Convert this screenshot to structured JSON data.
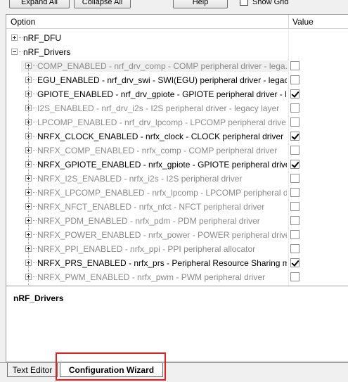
{
  "toolbar": {
    "expand_all": "Expand All",
    "collapse_all": "Collapse All",
    "help": "Help",
    "show_grid": "Show Grid"
  },
  "header": {
    "option": "Option",
    "value": "Value"
  },
  "tree": {
    "groups": [
      {
        "label": "nRF_DFU"
      },
      {
        "label": "nRF_Drivers"
      }
    ],
    "items": [
      {
        "label": "COMP_ENABLED - nrf_drv_comp - COMP peripheral driver - lega...",
        "enabled": false,
        "checked": false
      },
      {
        "label": "EGU_ENABLED  - nrf_drv_swi - SWI(EGU) peripheral driver - legac...",
        "enabled": true,
        "checked": false
      },
      {
        "label": "GPIOTE_ENABLED - nrf_drv_gpiote - GPIOTE peripheral driver - le...",
        "enabled": true,
        "checked": true
      },
      {
        "label": "I2S_ENABLED - nrf_drv_i2s - I2S peripheral driver - legacy layer",
        "enabled": false,
        "checked": false
      },
      {
        "label": "LPCOMP_ENABLED - nrf_drv_lpcomp - LPCOMP peripheral drive...",
        "enabled": false,
        "checked": false
      },
      {
        "label": "NRFX_CLOCK_ENABLED - nrfx_clock - CLOCK peripheral driver",
        "enabled": true,
        "checked": true
      },
      {
        "label": "NRFX_COMP_ENABLED - nrfx_comp - COMP peripheral driver",
        "enabled": false,
        "checked": false
      },
      {
        "label": "NRFX_GPIOTE_ENABLED - nrfx_gpiote - GPIOTE peripheral driver",
        "enabled": true,
        "checked": true
      },
      {
        "label": "NRFX_I2S_ENABLED - nrfx_i2s - I2S peripheral driver",
        "enabled": false,
        "checked": false
      },
      {
        "label": "NRFX_LPCOMP_ENABLED - nrfx_lpcomp - LPCOMP peripheral driv...",
        "enabled": false,
        "checked": false
      },
      {
        "label": "NRFX_NFCT_ENABLED - nrfx_nfct - NFCT peripheral driver",
        "enabled": false,
        "checked": false
      },
      {
        "label": "NRFX_PDM_ENABLED - nrfx_pdm - PDM peripheral driver",
        "enabled": false,
        "checked": false
      },
      {
        "label": "NRFX_POWER_ENABLED - nrfx_power - POWER peripheral driver",
        "enabled": false,
        "checked": false
      },
      {
        "label": "NRFX_PPI_ENABLED - nrfx_ppi - PPI peripheral allocator",
        "enabled": false,
        "checked": false
      },
      {
        "label": "NRFX_PRS_ENABLED - nrfx_prs - Peripheral Resource Sharing mo...",
        "enabled": true,
        "checked": true
      },
      {
        "label": "NRFX_PWM_ENABLED - nrfx_pwm - PWM peripheral driver",
        "enabled": false,
        "checked": false
      }
    ]
  },
  "description": {
    "title": "nRF_Drivers"
  },
  "tabs": {
    "text_editor": "Text Editor",
    "config_wizard": "Configuration Wizard"
  },
  "colors": {
    "highlight_box": "#e02020",
    "disabled_text": "#8a8a8a"
  }
}
